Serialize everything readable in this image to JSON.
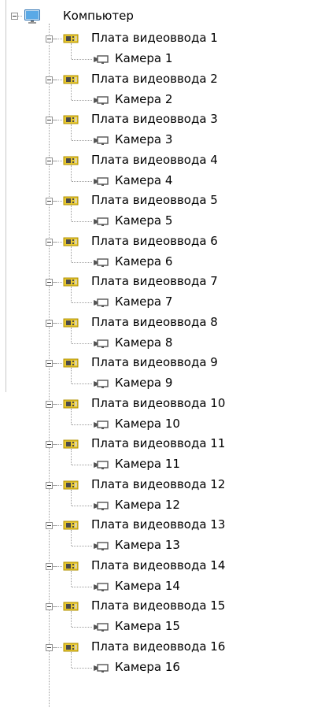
{
  "tree": {
    "root": {
      "label": "Компьютер",
      "icon": "computer-icon",
      "expanded": true
    },
    "boards": [
      {
        "label": "Плата видеоввода 1",
        "icon": "video-board-icon",
        "camera": {
          "label": "Камера 1",
          "icon": "camera-icon"
        }
      },
      {
        "label": "Плата видеоввода 2",
        "icon": "video-board-icon",
        "camera": {
          "label": "Камера 2",
          "icon": "camera-icon"
        }
      },
      {
        "label": "Плата видеоввода 3",
        "icon": "video-board-icon",
        "camera": {
          "label": "Камера 3",
          "icon": "camera-icon"
        }
      },
      {
        "label": "Плата видеоввода 4",
        "icon": "video-board-icon",
        "camera": {
          "label": "Камера 4",
          "icon": "camera-icon"
        }
      },
      {
        "label": "Плата видеоввода 5",
        "icon": "video-board-icon",
        "camera": {
          "label": "Камера 5",
          "icon": "camera-icon"
        }
      },
      {
        "label": "Плата видеоввода 6",
        "icon": "video-board-icon",
        "camera": {
          "label": "Камера 6",
          "icon": "camera-icon"
        }
      },
      {
        "label": "Плата видеоввода 7",
        "icon": "video-board-icon",
        "camera": {
          "label": "Камера 7",
          "icon": "camera-icon"
        }
      },
      {
        "label": "Плата видеоввода 8",
        "icon": "video-board-icon",
        "camera": {
          "label": "Камера 8",
          "icon": "camera-icon"
        }
      },
      {
        "label": "Плата видеоввода 9",
        "icon": "video-board-icon",
        "camera": {
          "label": "Камера 9",
          "icon": "camera-icon"
        }
      },
      {
        "label": "Плата видеоввода 10",
        "icon": "video-board-icon",
        "camera": {
          "label": "Камера 10",
          "icon": "camera-icon"
        }
      },
      {
        "label": "Плата видеоввода 11",
        "icon": "video-board-icon",
        "camera": {
          "label": "Камера 11",
          "icon": "camera-icon"
        }
      },
      {
        "label": "Плата видеоввода 12",
        "icon": "video-board-icon",
        "camera": {
          "label": "Камера 12",
          "icon": "camera-icon"
        }
      },
      {
        "label": "Плата видеоввода 13",
        "icon": "video-board-icon",
        "camera": {
          "label": "Камера 13",
          "icon": "camera-icon"
        }
      },
      {
        "label": "Плата видеоввода 14",
        "icon": "video-board-icon",
        "camera": {
          "label": "Камера 14",
          "icon": "camera-icon"
        }
      },
      {
        "label": "Плата видеоввода 15",
        "icon": "video-board-icon",
        "camera": {
          "label": "Камера 15",
          "icon": "camera-icon"
        }
      },
      {
        "label": "Плата видеоввода 16",
        "icon": "video-board-icon",
        "camera": {
          "label": "Камера 16",
          "icon": "camera-icon"
        }
      }
    ]
  },
  "colors": {
    "tree_line": "#a0a0a0",
    "expander_border": "#919191",
    "board_icon_yellow": "#e8c830",
    "board_icon_dark": "#4a4a4a",
    "computer_screen": "#5aa9e6",
    "camera_body": "#555555"
  }
}
